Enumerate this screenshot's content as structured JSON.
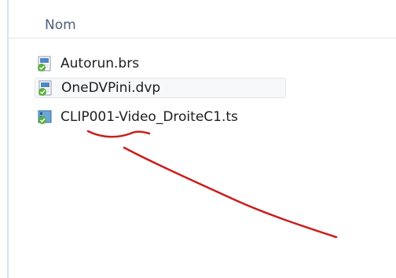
{
  "header": {
    "column_name": "Nom"
  },
  "files": [
    {
      "name": "Autorun.brs",
      "icon": "script-file-icon",
      "selected": false
    },
    {
      "name": "OneDVPini.dvp",
      "icon": "script-file-icon",
      "selected": true
    },
    {
      "name": "CLIP001-Video_DroiteC1.ts",
      "icon": "video-file-icon",
      "selected": false
    }
  ],
  "annotation": {
    "color": "#cc1c1c",
    "description": "red hand-drawn underline under 'CLIP001' with an arrow line pointing to it"
  }
}
